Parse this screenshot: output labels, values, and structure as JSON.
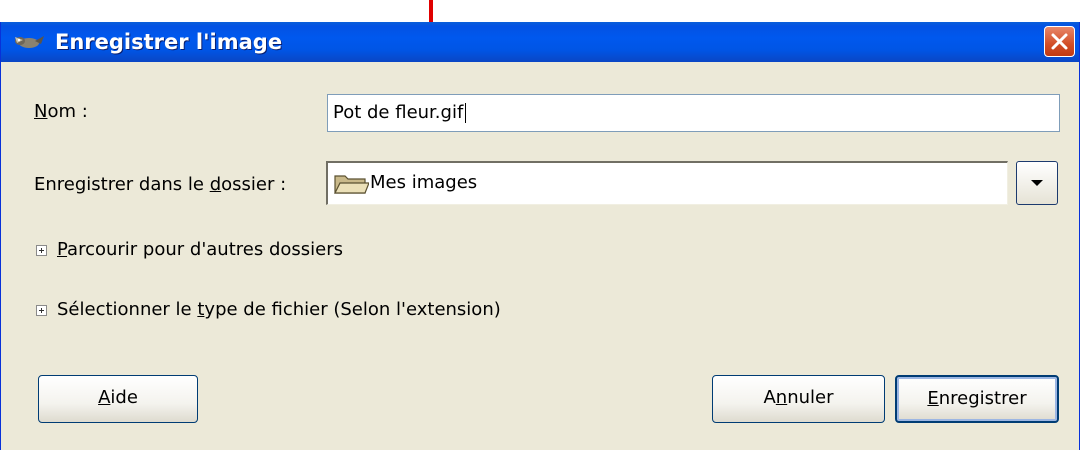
{
  "window": {
    "title": "Enregistrer l'image"
  },
  "form": {
    "name_label_u": "N",
    "name_label_rest": "om :",
    "name_value": "Pot de fleur.gif",
    "folder_label_before": "Enregistrer dans le ",
    "folder_label_u": "d",
    "folder_label_after": "ossier :",
    "folder_value": "Mes images",
    "browse_u": "P",
    "browse_rest": "arcourir pour d'autres dossiers",
    "filetype_before": "Sélectionner le ",
    "filetype_u": "t",
    "filetype_after": "ype de fichier (Selon l'extension)"
  },
  "buttons": {
    "help_u": "A",
    "help_rest": "ide",
    "cancel_before": "A",
    "cancel_u": "n",
    "cancel_after": "nuler",
    "save_u": "E",
    "save_rest": "nregistrer"
  },
  "icons": {
    "app": "gimp-wilber-icon",
    "close": "close-icon",
    "folder": "folder-icon",
    "dropdown": "chevron-down-icon",
    "expander": "expander-plus-icon"
  },
  "colors": {
    "titlebar": "#0055e5",
    "window_bg": "#ece9d8",
    "annotation_arrow": "#e00000",
    "close_button": "#d24e27"
  }
}
